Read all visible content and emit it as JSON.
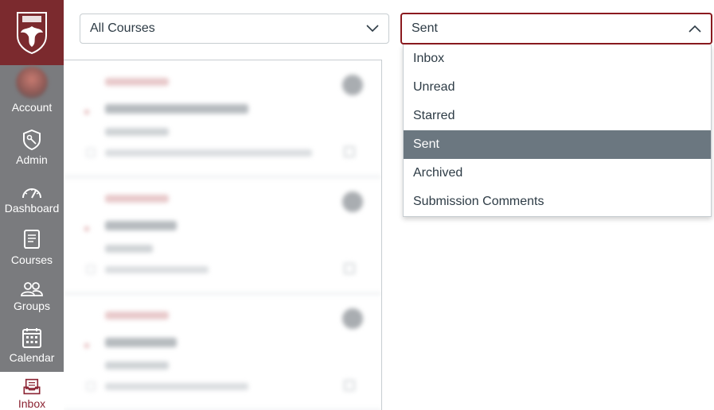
{
  "nav": {
    "items": [
      {
        "key": "account",
        "label": "Account",
        "icon": "avatar"
      },
      {
        "key": "admin",
        "label": "Admin",
        "icon": "shield-icon"
      },
      {
        "key": "dashboard",
        "label": "Dashboard",
        "icon": "dashboard-icon"
      },
      {
        "key": "courses",
        "label": "Courses",
        "icon": "book-icon"
      },
      {
        "key": "groups",
        "label": "Groups",
        "icon": "groups-icon"
      },
      {
        "key": "calendar",
        "label": "Calendar",
        "icon": "calendar-icon"
      },
      {
        "key": "inbox",
        "label": "Inbox",
        "icon": "inbox-icon",
        "active": true
      }
    ],
    "colors": {
      "brand": "#7b2a2e",
      "nav_bg": "#7a7b7e",
      "active_text": "#8b2332"
    }
  },
  "filters": {
    "course": {
      "value": "All Courses"
    },
    "mailbox": {
      "value": "Sent",
      "options": [
        "Inbox",
        "Unread",
        "Starred",
        "Sent",
        "Archived",
        "Submission Comments"
      ],
      "selected_index": 3
    }
  }
}
